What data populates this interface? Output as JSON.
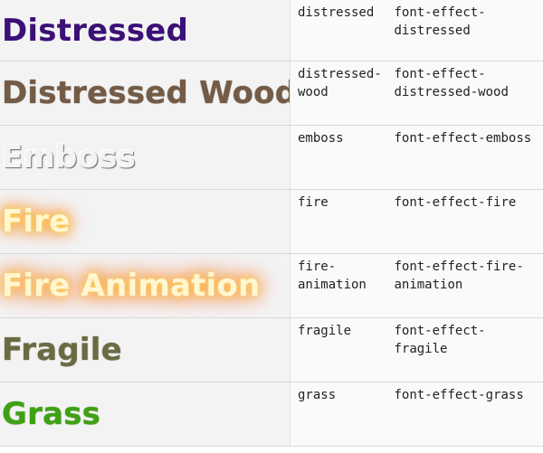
{
  "rows": [
    {
      "sample": "Distressed",
      "name": "distressed",
      "cls": "font-effect-\ndistressed",
      "fx": "distressed",
      "color": "#3b1077"
    },
    {
      "sample": "Distressed Wood",
      "name": "distressed-\nwood",
      "cls": "font-effect-\ndistressed-wood",
      "fx": "wood",
      "color": "#735b46"
    },
    {
      "sample": "Emboss",
      "name": "emboss",
      "cls": "font-effect-emboss",
      "fx": "emboss",
      "color": "#f3f3f3"
    },
    {
      "sample": "Fire",
      "name": "fire",
      "cls": "font-effect-fire",
      "fx": "fire",
      "color": "#fff7d1"
    },
    {
      "sample": "Fire Animation",
      "name": "fire-\nanimation",
      "cls": "font-effect-fire-\nanimation",
      "fx": "fireanim",
      "color": "#fff7d1"
    },
    {
      "sample": "Fragile",
      "name": "fragile",
      "cls": "font-effect-\nfragile",
      "fx": "fragile",
      "color": "#6b6b43"
    },
    {
      "sample": "Grass",
      "name": "grass",
      "cls": "font-effect-grass",
      "fx": "grass",
      "color": "#3ea114"
    }
  ]
}
